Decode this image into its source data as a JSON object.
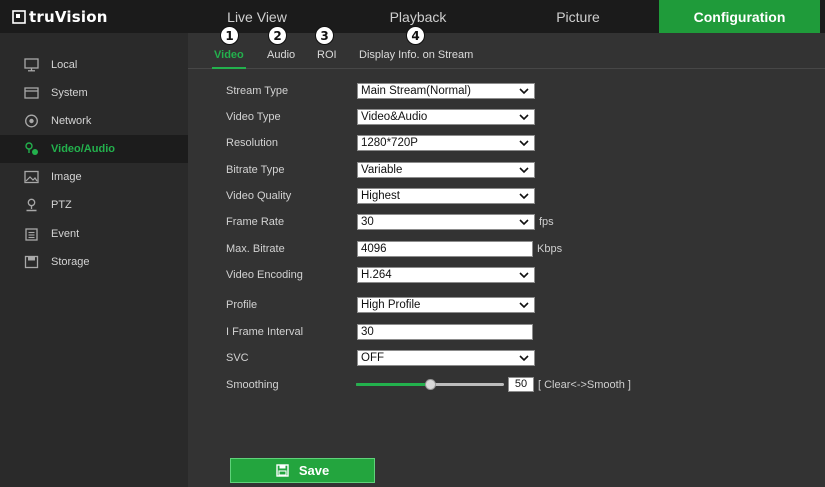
{
  "app": {
    "logo_text": "truVision"
  },
  "nav": [
    {
      "label": "Live View",
      "active": false
    },
    {
      "label": "Playback",
      "active": false
    },
    {
      "label": "Picture",
      "active": false
    },
    {
      "label": "Configuration",
      "active": true
    }
  ],
  "sidebar": {
    "items": [
      {
        "label": "Local",
        "icon": "monitor-icon",
        "active": false
      },
      {
        "label": "System",
        "icon": "system-icon",
        "active": false
      },
      {
        "label": "Network",
        "icon": "network-icon",
        "active": false
      },
      {
        "label": "Video/Audio",
        "icon": "video-audio-icon",
        "active": true
      },
      {
        "label": "Image",
        "icon": "image-icon",
        "active": false
      },
      {
        "label": "PTZ",
        "icon": "ptz-icon",
        "active": false
      },
      {
        "label": "Event",
        "icon": "event-icon",
        "active": false
      },
      {
        "label": "Storage",
        "icon": "storage-icon",
        "active": false
      }
    ]
  },
  "subtabs": [
    {
      "label": "Video",
      "callout": "1",
      "active": true
    },
    {
      "label": "Audio",
      "callout": "2",
      "active": false
    },
    {
      "label": "ROI",
      "callout": "3",
      "active": false
    },
    {
      "label": "Display Info. on Stream",
      "callout": "4",
      "active": false
    }
  ],
  "form": {
    "stream_type": {
      "label": "Stream Type",
      "value": "Main Stream(Normal)"
    },
    "video_type": {
      "label": "Video Type",
      "value": "Video&Audio"
    },
    "resolution": {
      "label": "Resolution",
      "value": "1280*720P"
    },
    "bitrate_type": {
      "label": "Bitrate Type",
      "value": "Variable"
    },
    "video_quality": {
      "label": "Video Quality",
      "value": "Highest"
    },
    "frame_rate": {
      "label": "Frame Rate",
      "value": "30",
      "unit": "fps"
    },
    "max_bitrate": {
      "label": "Max. Bitrate",
      "value": "4096",
      "unit": "Kbps"
    },
    "video_encoding": {
      "label": "Video Encoding",
      "value": "H.264"
    },
    "profile": {
      "label": "Profile",
      "value": "High Profile"
    },
    "i_frame_interval": {
      "label": "I Frame Interval",
      "value": "30"
    },
    "svc": {
      "label": "SVC",
      "value": "OFF"
    },
    "smoothing": {
      "label": "Smoothing",
      "value": "50",
      "level_percent": 50,
      "hint": "[ Clear<->Smooth ]"
    }
  },
  "actions": {
    "save_label": "Save"
  },
  "colors": {
    "accent": "#23b14d",
    "nav_active_bg": "#1f9b3a",
    "save_bg": "#23a53e"
  }
}
